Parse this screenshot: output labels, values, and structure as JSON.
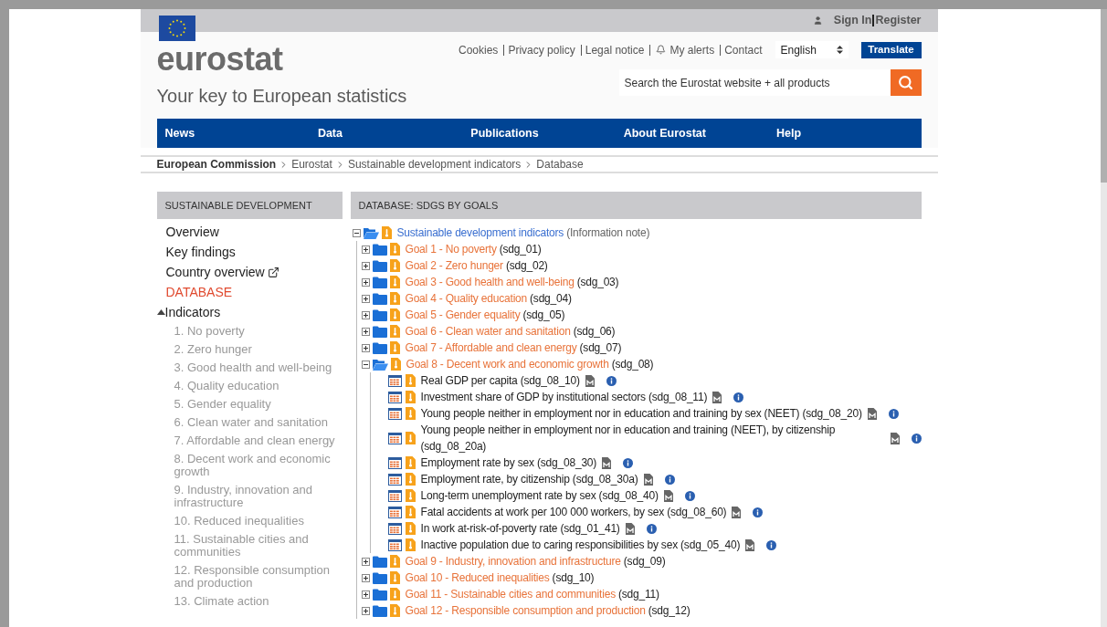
{
  "header": {
    "account_links": [
      "Sign In",
      "Register"
    ],
    "logo": "eurostat",
    "tagline": "Your key to European statistics",
    "links": [
      "Cookies",
      "Privacy policy",
      "Legal notice",
      "My alerts",
      "Contact"
    ],
    "language": "English",
    "translate_button": "Translate",
    "search": {
      "placeholder": "Search the Eurostat website + all products"
    }
  },
  "nav": [
    "News",
    "Data",
    "Publications",
    "About Eurostat",
    "Help"
  ],
  "breadcrumb": [
    "European Commission",
    "Eurostat",
    "Sustainable development indicators",
    "Database"
  ],
  "sidebar": {
    "title": "SUSTAINABLE DEVELOPMENT",
    "items": [
      {
        "label": "Overview",
        "kind": "link",
        "selected": false
      },
      {
        "label": "Key findings",
        "kind": "link",
        "selected": false
      },
      {
        "label": "Country overview",
        "kind": "external",
        "selected": false
      },
      {
        "label": "DATABASE",
        "kind": "link",
        "selected": true
      },
      {
        "label": "Indicators",
        "kind": "group",
        "selected": false,
        "expanded": true,
        "children": [
          "1. No poverty",
          "2. Zero hunger",
          "3. Good health and well-being",
          "4. Quality education",
          "5. Gender equality",
          "6. Clean water and sanitation",
          "7. Affordable and clean energy",
          "8. Decent work and economic growth",
          "9. Industry, innovation and infrastructure",
          "10. Reduced inequalities",
          "11. Sustainable cities and communities",
          "12. Responsible consumption and production",
          "13. Climate action"
        ]
      }
    ]
  },
  "main": {
    "title": "DATABASE: SDGS BY GOALS",
    "tree": {
      "label": "Sustainable development indicators",
      "note": "(Information note)",
      "expanded": true,
      "children": [
        {
          "label": "Goal 1 - No poverty",
          "code": "(sdg_01)",
          "expanded": false
        },
        {
          "label": "Goal 2 - Zero hunger",
          "code": "(sdg_02)",
          "expanded": false
        },
        {
          "label": "Goal 3 - Good health and well-being",
          "code": "(sdg_03)",
          "expanded": false
        },
        {
          "label": "Goal 4 - Quality education",
          "code": "(sdg_04)",
          "expanded": false
        },
        {
          "label": "Goal 5 - Gender equality",
          "code": "(sdg_05)",
          "expanded": false
        },
        {
          "label": "Goal 6 - Clean water and sanitation",
          "code": "(sdg_06)",
          "expanded": false
        },
        {
          "label": "Goal 7 - Affordable and clean energy",
          "code": "(sdg_07)",
          "expanded": false
        },
        {
          "label": "Goal 8 - Decent work and economic growth",
          "code": "(sdg_08)",
          "expanded": true,
          "children": [
            {
              "label": "Real GDP per capita",
              "code": "(sdg_08_10)"
            },
            {
              "label": "Investment share of GDP by institutional sectors",
              "code": "(sdg_08_11)"
            },
            {
              "label": "Young people neither in employment nor in education and training by sex (NEET)",
              "code": "(sdg_08_20)"
            },
            {
              "label": "Young people neither in employment nor in education and training (NEET), by citizenship",
              "code": "(sdg_08_20a)"
            },
            {
              "label": "Employment rate by sex",
              "code": "(sdg_08_30)"
            },
            {
              "label": "Employment rate, by citizenship",
              "code": "(sdg_08_30a)"
            },
            {
              "label": "Long-term unemployment rate by sex",
              "code": "(sdg_08_40)"
            },
            {
              "label": "Fatal accidents at work per 100 000 workers, by sex",
              "code": "(sdg_08_60)"
            },
            {
              "label": "In work at-risk-of-poverty rate",
              "code": "(sdg_01_41)"
            },
            {
              "label": "Inactive population due to caring responsibilities by sex",
              "code": "(sdg_05_40)"
            }
          ]
        },
        {
          "label": "Goal 9 - Industry, innovation and infrastructure",
          "code": "(sdg_09)",
          "expanded": false
        },
        {
          "label": "Goal 10 - Reduced inequalities",
          "code": "(sdg_10)",
          "expanded": false
        },
        {
          "label": "Goal 11 - Sustainable cities and communities",
          "code": "(sdg_11)",
          "expanded": false
        },
        {
          "label": "Goal 12 - Responsible consumption and production",
          "code": "(sdg_12)",
          "expanded": false
        }
      ]
    }
  }
}
